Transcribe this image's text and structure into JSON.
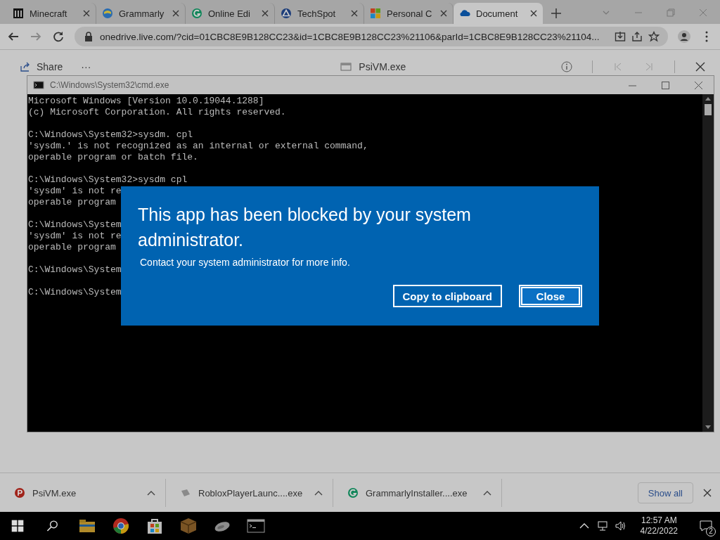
{
  "browser": {
    "tabs": [
      {
        "title": "Minecraft",
        "kind": "columns",
        "selected": false
      },
      {
        "title": "Grammarly",
        "kind": "globe",
        "selected": false
      },
      {
        "title": "Online Edi",
        "kind": "ring",
        "selected": false
      },
      {
        "title": "TechSpot",
        "kind": "triangle",
        "selected": false
      },
      {
        "title": "Personal C",
        "kind": "squares",
        "selected": false
      },
      {
        "title": "Document",
        "kind": "cloud",
        "selected": true
      }
    ],
    "url": "onedrive.live.com/?cid=01CBC8E9B128CC23&id=1CBC8E9B128CC23%21106&parId=1CBC8E9B128CC23%21104..."
  },
  "viewer_toolbar": {
    "share": "Share",
    "more": "···",
    "file_name": "PsiVM.exe"
  },
  "console_window": {
    "title": "C:\\Windows\\System32\\cmd.exe",
    "blocks": [
      [
        "Microsoft Windows [Version 10.0.19044.1288]",
        "(c) Microsoft Corporation. All rights reserved."
      ],
      [
        "C:\\Windows\\System32>sysdm. cpl",
        "'sysdm.' is not recognized as an internal or external command,",
        "operable program or batch file."
      ],
      [
        "C:\\Windows\\System32>sysdm cpl",
        "'sysdm' is not re",
        "operable program"
      ],
      [
        "C:\\Windows\\System",
        "'sysdm' is not re",
        "operable program"
      ],
      [
        "C:\\Windows\\System"
      ],
      [
        "C:\\Windows\\System"
      ]
    ]
  },
  "dialog": {
    "title": "This app has been blocked by your system administrator.",
    "message": "Contact your system administrator for more info.",
    "buttons": [
      {
        "label": "Copy to clipboard",
        "selected": false
      },
      {
        "label": "Close",
        "selected": true
      }
    ]
  },
  "downloads": {
    "items": [
      {
        "name": "PsiVM.exe",
        "kind": "psi"
      },
      {
        "name": "RobloxPlayerLaunc....exe",
        "kind": "file"
      },
      {
        "name": "GrammarlyInstaller....exe",
        "kind": "ring"
      }
    ],
    "show_all": "Show all"
  },
  "taskbar": {
    "apps": [
      {
        "kind": "folder"
      },
      {
        "kind": "chrome"
      },
      {
        "kind": "store"
      },
      {
        "kind": "crate"
      },
      {
        "kind": "mouse"
      },
      {
        "kind": "terminal"
      }
    ],
    "time": "12:57 AM",
    "date": "4/22/2022",
    "notifications": "2"
  }
}
